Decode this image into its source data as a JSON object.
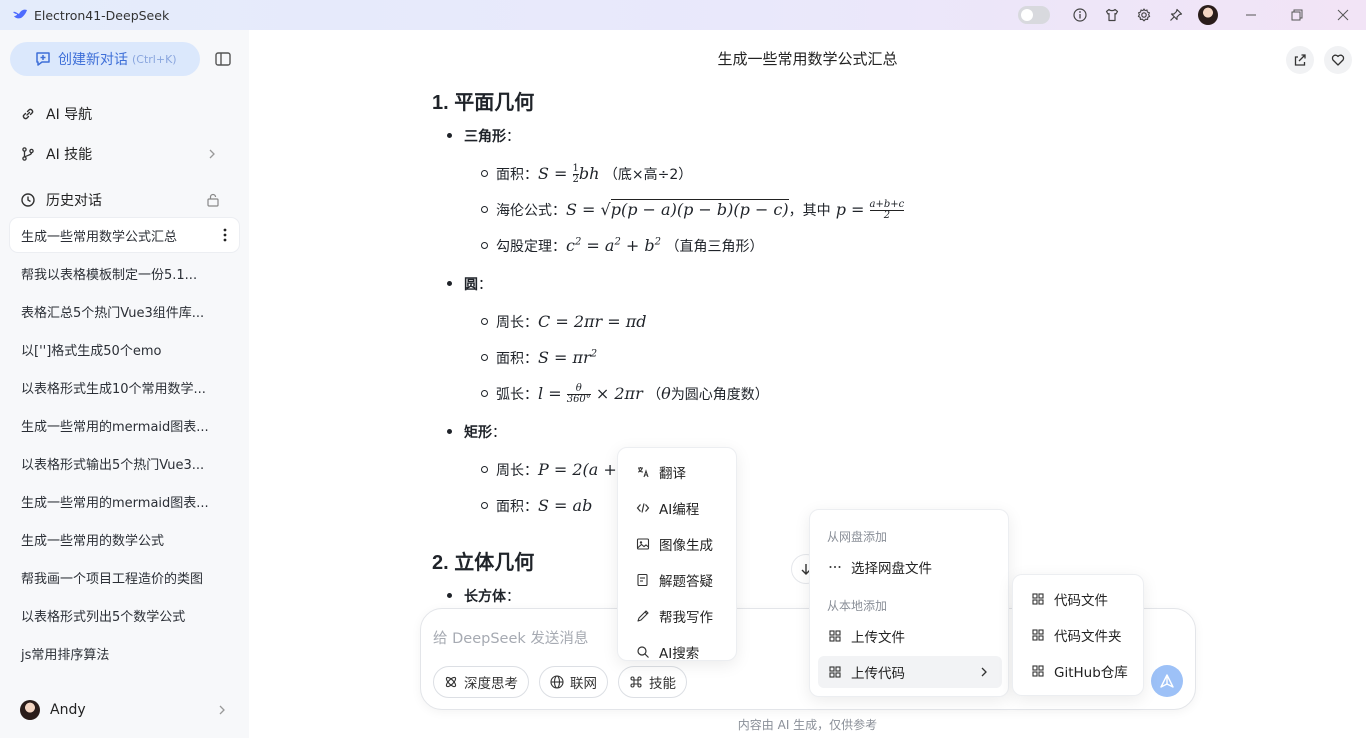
{
  "window": {
    "title": "Electron41-DeepSeek"
  },
  "sidebar": {
    "new_chat_label": "创建新对话",
    "new_chat_shortcut": "(Ctrl+K)",
    "nav": [
      {
        "label": "AI 导航"
      },
      {
        "label": "AI 技能"
      }
    ],
    "history_label": "历史对话",
    "history": [
      "生成一些常用数学公式汇总",
      "帮我以表格模板制定一份5.1...",
      "表格汇总5个热门Vue3组件库...",
      "以['']格式生成50个emo",
      "以表格形式生成10个常用数学...",
      "生成一些常用的mermaid图表...",
      "以表格形式输出5个热门Vue3...",
      "生成一些常用的mermaid图表...",
      "生成一些常用的数学公式",
      "帮我画一个项目工程造价的类图",
      "以表格形式列出5个数学公式",
      "js常用排序算法"
    ],
    "user_name": "Andy"
  },
  "chat": {
    "title": "生成一些常用数学公式汇总",
    "section1": "1. 平面几何",
    "triangle": "三角形",
    "tri_area_label": "面积：",
    "tri_area_note": "（底×高÷2）",
    "heron_label": "海伦公式：",
    "heron_where": "，其中",
    "pyth_label": "勾股定理：",
    "pyth_note": "（直角三角形）",
    "circle": "圆",
    "circ_perim_label": "周长：",
    "circ_area_label": "面积：",
    "arc_label": "弧长：",
    "arc_note_pre": "（",
    "arc_note": "为圆心角度数）",
    "rect": "矩形",
    "rect_perim_label": "周长：",
    "rect_area_label": "面积：",
    "section2": "2. 立体几何",
    "cuboid": "长方体",
    "colon": "："
  },
  "composer": {
    "placeholder": "给 DeepSeek 发送消息",
    "chips": [
      "深度思考",
      "联网",
      "技能"
    ],
    "footer": "内容由 AI 生成，仅供参考"
  },
  "skills_menu": [
    "翻译",
    "AI编程",
    "图像生成",
    "解题答疑",
    "帮我写作",
    "AI搜索"
  ],
  "upload_menu": {
    "group_cloud": "从网盘添加",
    "pick_cloud": "选择网盘文件",
    "group_local": "从本地添加",
    "upload_file": "上传文件",
    "upload_code": "上传代码"
  },
  "code_submenu": [
    "代码文件",
    "代码文件夹",
    "GitHub仓库"
  ]
}
